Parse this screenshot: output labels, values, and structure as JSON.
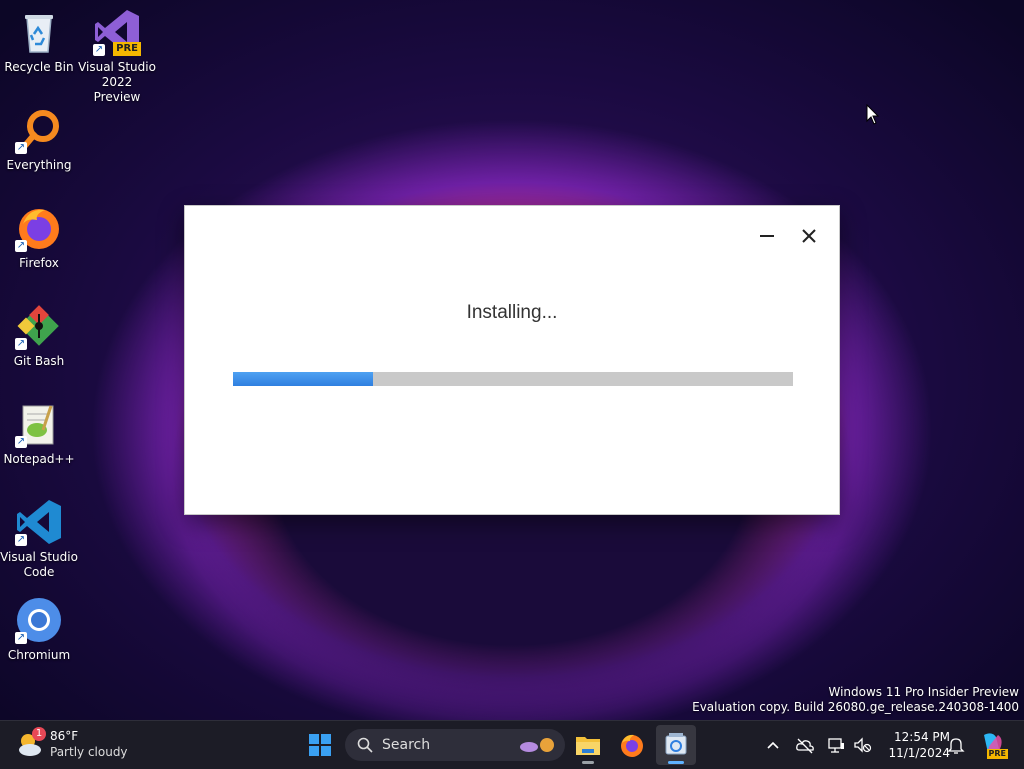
{
  "desktop": {
    "icons": [
      {
        "label": "Recycle Bin",
        "icon": "recycle-bin-icon"
      },
      {
        "label": "Visual Studio 2022 Preview",
        "icon": "visual-studio-icon",
        "badge": "PRE"
      },
      {
        "label": "Everything",
        "icon": "everything-icon"
      },
      {
        "label": "Firefox",
        "icon": "firefox-icon"
      },
      {
        "label": "Git Bash",
        "icon": "git-bash-icon"
      },
      {
        "label": "Notepad++",
        "icon": "notepadpp-icon"
      },
      {
        "label": "Visual Studio Code",
        "icon": "vscode-icon"
      },
      {
        "label": "Chromium",
        "icon": "chromium-icon"
      }
    ],
    "watermark": {
      "line1": "Windows 11 Pro Insider Preview",
      "line2": "Evaluation copy. Build 26080.ge_release.240308-1400"
    }
  },
  "dialog": {
    "status_text": "Installing...",
    "progress_fraction": 0.25,
    "accent_color": "#2f7fe0"
  },
  "taskbar": {
    "weather": {
      "temperature": "86°F",
      "condition": "Partly cloudy",
      "alert_count": "1"
    },
    "search_placeholder": "Search",
    "pinned": [
      "start-icon",
      "file-explorer-icon",
      "firefox-icon",
      "installer-icon"
    ],
    "clock": {
      "time": "12:54 PM",
      "date": "11/1/2024"
    },
    "copilot_badge": "PRE"
  }
}
